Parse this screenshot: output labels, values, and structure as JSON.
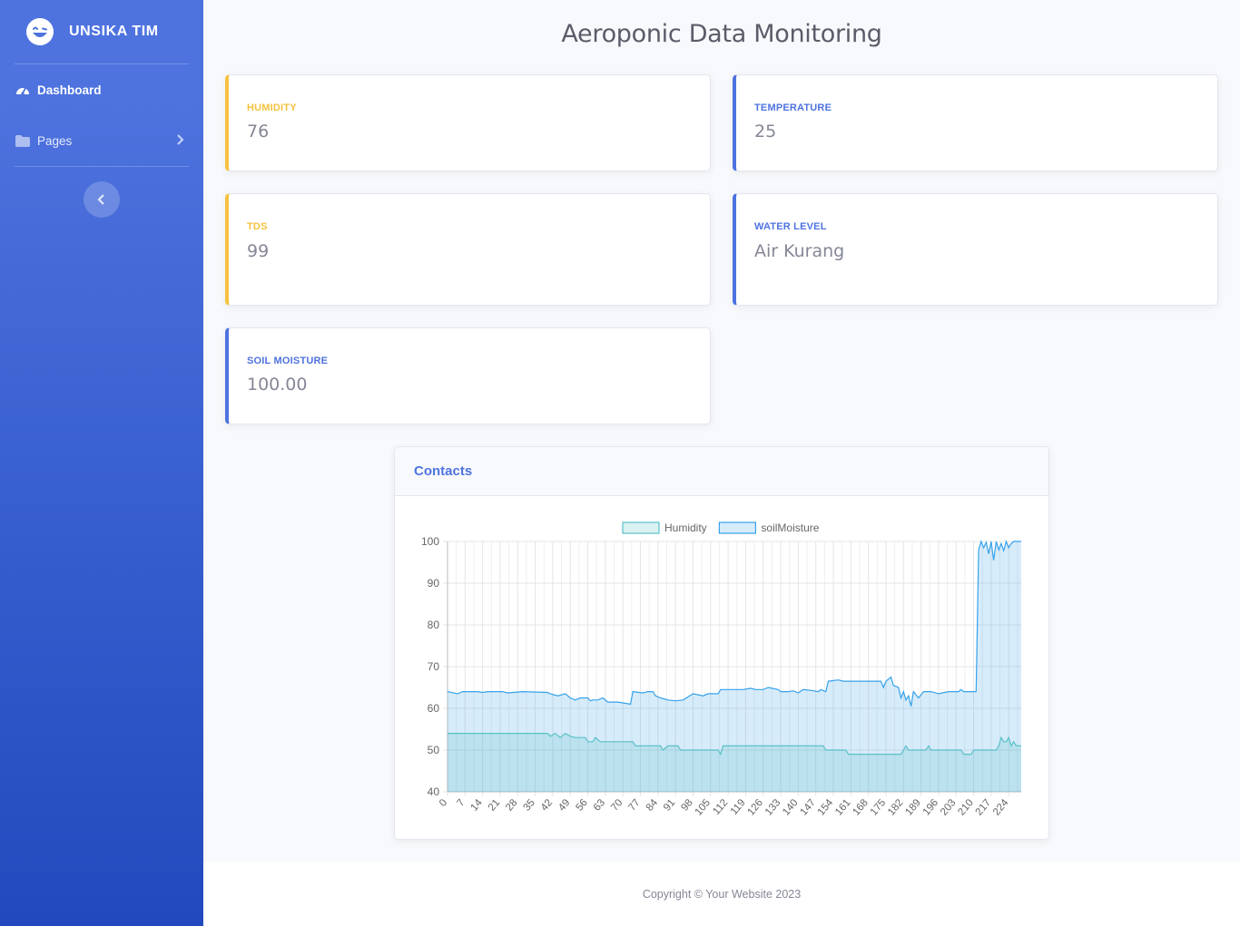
{
  "sidebar": {
    "brand": "UNSIKA TIM",
    "items": [
      {
        "label": "Dashboard",
        "icon": "tachometer-icon"
      },
      {
        "label": "Pages",
        "icon": "folder-icon"
      }
    ],
    "toggle_icon": "chevron-left-icon"
  },
  "header": {
    "title": "Aeroponic Data Monitoring"
  },
  "cards": {
    "humidity": {
      "label": "HUMIDITY",
      "value": "76"
    },
    "temperature": {
      "label": "TEMPERATURE",
      "value": "25"
    },
    "tds": {
      "label": "TDS",
      "value": "99"
    },
    "water_level": {
      "label": "WATER LEVEL",
      "value": "Air Kurang"
    },
    "soil_moisture": {
      "label": "SOIL MOISTURE",
      "value": "100.00"
    }
  },
  "chart": {
    "title": "Contacts"
  },
  "chart_data": {
    "type": "area",
    "ylim": [
      40,
      100
    ],
    "yticks": [
      40,
      50,
      60,
      70,
      80,
      90,
      100
    ],
    "x_count": 230,
    "xticks": [
      0,
      7,
      14,
      21,
      28,
      35,
      42,
      49,
      56,
      63,
      70,
      77,
      84,
      91,
      98,
      105,
      112,
      119,
      126,
      133,
      140,
      147,
      154,
      161,
      168,
      175,
      182,
      189,
      196,
      203,
      210,
      217,
      224
    ],
    "grid": true,
    "legend_position": "top",
    "series": [
      {
        "name": "Humidity",
        "color": "#5bc0c8",
        "fill": "rgba(75,192,192,0.2)",
        "points": [
          [
            0,
            54
          ],
          [
            40,
            54
          ],
          [
            41,
            53.3
          ],
          [
            43,
            54
          ],
          [
            45,
            53
          ],
          [
            47,
            54
          ],
          [
            49,
            53.3
          ],
          [
            51,
            53
          ],
          [
            55,
            53
          ],
          [
            56,
            52
          ],
          [
            58,
            52
          ],
          [
            59,
            53
          ],
          [
            61,
            52
          ],
          [
            74,
            52
          ],
          [
            75,
            51
          ],
          [
            85,
            51
          ],
          [
            86,
            50
          ],
          [
            88,
            51
          ],
          [
            92,
            51
          ],
          [
            93,
            50
          ],
          [
            108,
            50
          ],
          [
            109,
            49
          ],
          [
            110,
            51
          ],
          [
            150,
            51
          ],
          [
            151,
            50
          ],
          [
            159,
            50
          ],
          [
            160,
            49
          ],
          [
            181,
            49
          ],
          [
            182,
            50
          ],
          [
            183,
            51
          ],
          [
            184,
            50
          ],
          [
            191,
            50
          ],
          [
            192,
            51
          ],
          [
            193,
            50
          ],
          [
            205,
            50
          ],
          [
            206,
            49
          ],
          [
            209,
            49
          ],
          [
            210,
            50
          ],
          [
            219,
            50
          ],
          [
            220,
            51
          ],
          [
            221,
            53
          ],
          [
            222,
            52
          ],
          [
            223,
            52
          ],
          [
            224,
            53
          ],
          [
            225,
            51
          ],
          [
            226,
            52
          ],
          [
            227,
            51
          ],
          [
            229,
            51
          ]
        ]
      },
      {
        "name": "soilMoisture",
        "color": "#36a2eb",
        "fill": "rgba(54,162,235,0.2)",
        "points": [
          [
            0,
            64
          ],
          [
            4,
            63.5
          ],
          [
            6,
            64
          ],
          [
            12,
            64
          ],
          [
            14,
            63.8
          ],
          [
            16,
            64
          ],
          [
            22,
            64
          ],
          [
            24,
            63.7
          ],
          [
            30,
            64
          ],
          [
            40,
            63.8
          ],
          [
            41,
            63.5
          ],
          [
            44,
            63
          ],
          [
            47,
            63.5
          ],
          [
            49,
            62.5
          ],
          [
            51,
            62
          ],
          [
            53,
            62.5
          ],
          [
            56,
            62.5
          ],
          [
            57,
            61.8
          ],
          [
            58,
            62
          ],
          [
            60,
            62
          ],
          [
            62,
            62.5
          ],
          [
            64,
            61.5
          ],
          [
            68,
            61.5
          ],
          [
            70,
            61.3
          ],
          [
            73,
            61
          ],
          [
            74,
            64
          ],
          [
            78,
            63.7
          ],
          [
            80,
            64
          ],
          [
            82,
            64
          ],
          [
            83,
            63
          ],
          [
            85,
            62.5
          ],
          [
            88,
            62
          ],
          [
            91,
            61.8
          ],
          [
            94,
            62
          ],
          [
            98,
            63.5
          ],
          [
            102,
            63
          ],
          [
            104,
            63.5
          ],
          [
            108,
            63.5
          ],
          [
            109,
            64.5
          ],
          [
            118,
            64.5
          ],
          [
            121,
            64.8
          ],
          [
            123,
            64.5
          ],
          [
            126,
            64.5
          ],
          [
            128,
            65
          ],
          [
            132,
            64.5
          ],
          [
            133,
            64
          ],
          [
            136,
            64
          ],
          [
            138,
            64.2
          ],
          [
            140,
            63.7
          ],
          [
            142,
            64.5
          ],
          [
            145,
            64.3
          ],
          [
            148,
            64
          ],
          [
            149,
            64.5
          ],
          [
            151,
            64
          ],
          [
            152,
            66.5
          ],
          [
            156,
            66.8
          ],
          [
            158,
            66.5
          ],
          [
            170,
            66.5
          ],
          [
            173,
            66.5
          ],
          [
            174,
            65
          ],
          [
            175,
            66.5
          ],
          [
            177,
            67.5
          ],
          [
            178,
            65.5
          ],
          [
            180,
            65
          ],
          [
            181,
            62.5
          ],
          [
            182,
            64
          ],
          [
            183,
            62
          ],
          [
            184,
            63
          ],
          [
            185,
            60.5
          ],
          [
            186,
            64
          ],
          [
            188,
            62.5
          ],
          [
            190,
            64
          ],
          [
            193,
            64
          ],
          [
            196,
            63.5
          ],
          [
            200,
            64
          ],
          [
            204,
            64
          ],
          [
            205,
            64.5
          ],
          [
            206,
            64
          ],
          [
            211,
            64
          ],
          [
            212,
            98
          ],
          [
            213,
            100
          ],
          [
            214,
            98.5
          ],
          [
            215,
            99.8
          ],
          [
            216,
            97
          ],
          [
            217,
            100
          ],
          [
            218,
            95.5
          ],
          [
            219,
            100
          ],
          [
            220,
            98
          ],
          [
            221,
            99.5
          ],
          [
            222,
            97.8
          ],
          [
            223,
            100
          ],
          [
            224,
            98.5
          ],
          [
            225,
            99.5
          ],
          [
            226,
            100
          ],
          [
            229,
            100
          ]
        ]
      }
    ]
  }
}
